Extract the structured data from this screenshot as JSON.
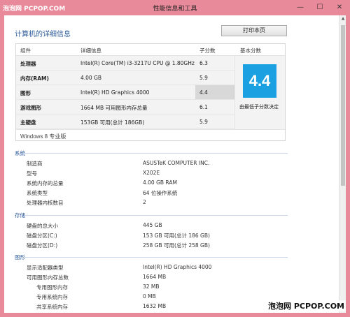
{
  "window": {
    "title": "性能信息和工具",
    "watermark_top": "泡泡网 PCPOP.COM",
    "watermark_bottom": "泡泡网 PCPOP.COM",
    "buttons": {
      "minimize": "—",
      "maximize": "☐",
      "close": "✕"
    }
  },
  "header": {
    "heading": "计算机的详细信息",
    "print_button": "打印本页"
  },
  "rating_table": {
    "columns": {
      "component": "组件",
      "details": "详细信息",
      "subscore": "子分数",
      "base_score": "基本分数"
    },
    "rows": [
      {
        "name": "处理器",
        "detail": "Intel(R) Core(TM) i3-3217U CPU @ 1.80GHz",
        "score": "6.3"
      },
      {
        "name": "内存(RAM)",
        "detail": "4.00 GB",
        "score": "5.9"
      },
      {
        "name": "图形",
        "detail": "Intel(R) HD Graphics 4000",
        "score": "4.4"
      },
      {
        "name": "游戏图形",
        "detail": "1664 MB 可用图形内存总量",
        "score": "6.1"
      },
      {
        "name": "主硬盘",
        "detail": "153GB 可用(总计 186GB)",
        "score": "5.9"
      }
    ],
    "base_score": "4.4",
    "base_caption": "由最低子分数决定",
    "os": "Windows 8 专业版"
  },
  "system": {
    "title": "系统",
    "rows": [
      {
        "k": "制造商",
        "v": "ASUSTeK COMPUTER INC."
      },
      {
        "k": "型号",
        "v": "X202E"
      },
      {
        "k": "系统内存的总量",
        "v": "4.00 GB RAM"
      },
      {
        "k": "系统类型",
        "v": "64 位操作系统"
      },
      {
        "k": "处理器内核数目",
        "v": "2"
      }
    ]
  },
  "storage": {
    "title": "存储",
    "rows": [
      {
        "k": "硬盘的总大小",
        "v": "445 GB"
      },
      {
        "k": "磁盘分区(C:)",
        "v": "153 GB 可用(总计 186 GB)"
      },
      {
        "k": "磁盘分区(D:)",
        "v": "258 GB 可用(总计 258 GB)"
      }
    ]
  },
  "graphics": {
    "title": "图形",
    "rows": [
      {
        "k": "显示适配器类型",
        "v": "Intel(R) HD Graphics 4000"
      },
      {
        "k": "可用图形内存总数",
        "v": "1664 MB"
      },
      {
        "k": "专用图形内存",
        "v": "32 MB"
      },
      {
        "k": "专用系统内存",
        "v": "0 MB"
      },
      {
        "k": "共享系统内存",
        "v": "1632 MB"
      }
    ]
  },
  "colors": {
    "titlebar": "#e88a9a",
    "score_tile": "#1ba1e2",
    "heading": "#2e5c9a"
  }
}
